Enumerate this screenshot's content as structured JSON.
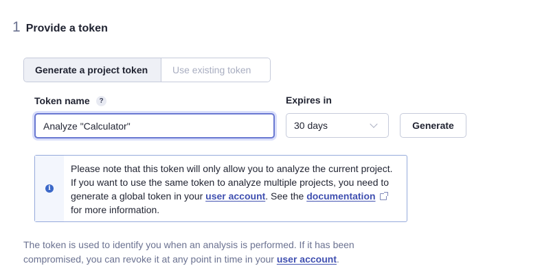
{
  "step": {
    "number": "1",
    "title": "Provide a token"
  },
  "token_mode": {
    "options": [
      "Generate a project token",
      "Use existing token"
    ],
    "selected": "Generate a project token"
  },
  "token_name": {
    "label": "Token name",
    "help_glyph": "?",
    "value": "Analyze \"Calculator\""
  },
  "expires": {
    "label": "Expires in",
    "selected": "30 days"
  },
  "generate_button": "Generate",
  "notice": {
    "icon": "info-icon",
    "text_1": "Please note that this token will only allow you to analyze the current project. If you want to use the same token to analyze multiple projects, you need to generate a global token in your ",
    "link_1": "user account",
    "text_2": ". See the ",
    "link_2": "documentation",
    "text_3": " for more information."
  },
  "footnote": {
    "text": "The token is used to identify you when an analysis is performed. If it has been compromised, you can revoke it at any point in time in your ",
    "link": "user account",
    "tail": "."
  }
}
